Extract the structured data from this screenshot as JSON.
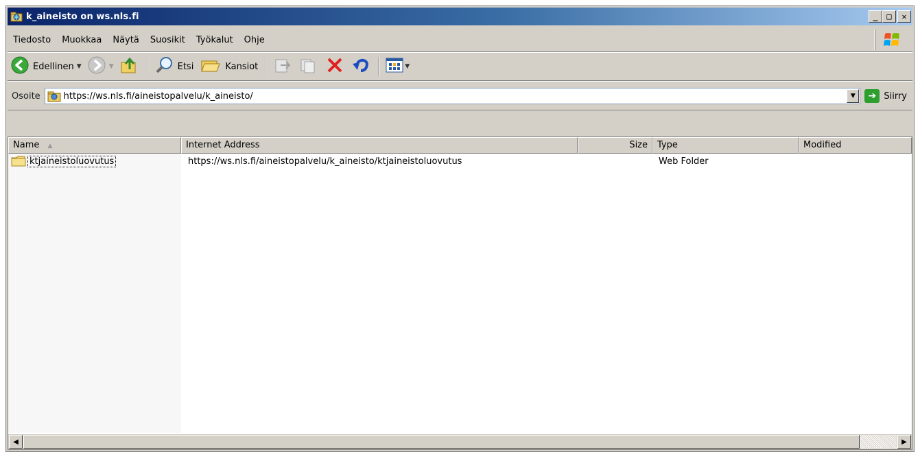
{
  "window": {
    "title": "k_aineisto on ws.nls.fi",
    "minimize": "_",
    "maximize": "□",
    "close": "✕"
  },
  "menubar": {
    "items": [
      "Tiedosto",
      "Muokkaa",
      "Näytä",
      "Suosikit",
      "Työkalut",
      "Ohje"
    ]
  },
  "toolbar": {
    "back_label": "Edellinen",
    "search_label": "Etsi",
    "folders_label": "Kansiot"
  },
  "address": {
    "label": "Osoite",
    "value": "https://ws.nls.fi/aineistopalvelu/k_aineisto/",
    "go_label": "Siirry"
  },
  "columns": {
    "name": "Name",
    "address": "Internet Address",
    "size": "Size",
    "type": "Type",
    "modified": "Modified"
  },
  "rows": [
    {
      "name": "ktjaineistoluovutus",
      "address": "https://ws.nls.fi/aineistopalvelu/k_aineisto/ktjaineistoluovutus",
      "size": "",
      "type": "Web Folder",
      "modified": ""
    }
  ],
  "colors": {
    "titlebar_start": "#0a246a",
    "titlebar_end": "#a6caf0",
    "chrome": "#d4d0c8"
  }
}
